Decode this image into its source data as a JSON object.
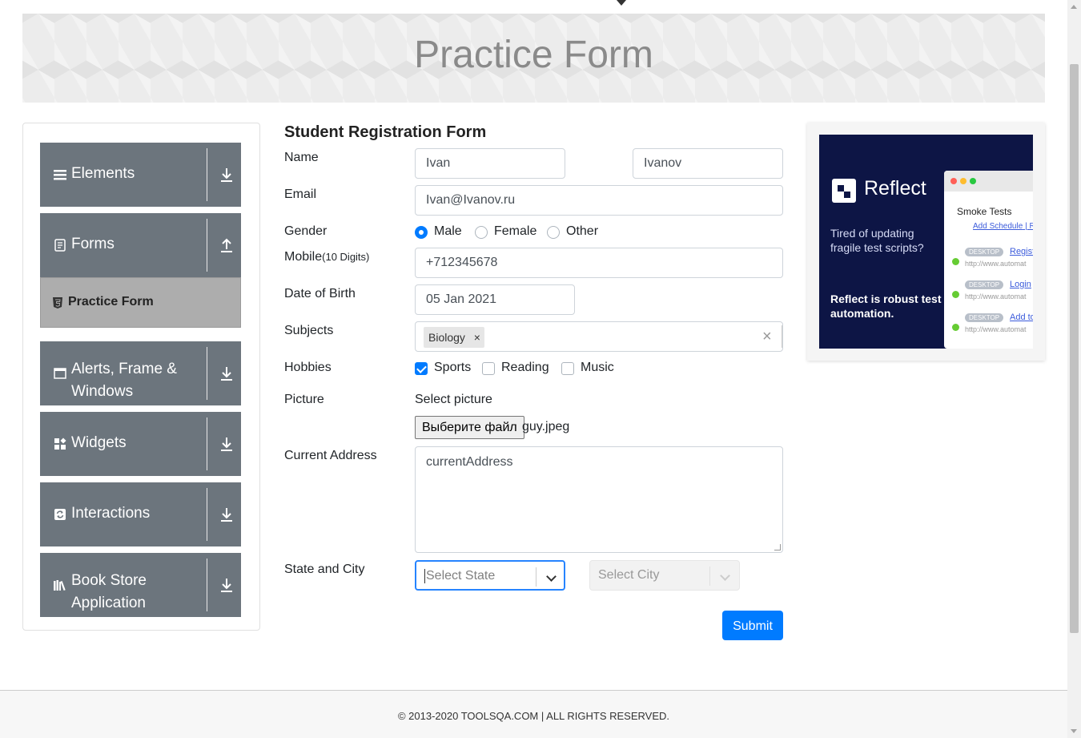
{
  "banner": {
    "title": "Practice Form"
  },
  "sidebar": {
    "groups": [
      {
        "label": "Elements",
        "icon": "hamburger-icon",
        "expanded": false
      },
      {
        "label": "Forms",
        "icon": "document-icon",
        "expanded": true
      },
      {
        "label": "Alerts, Frame & Windows",
        "icon": "window-icon",
        "expanded": false
      },
      {
        "label": "Widgets",
        "icon": "widgets-icon",
        "expanded": false
      },
      {
        "label": "Interactions",
        "icon": "refresh-icon",
        "expanded": false
      },
      {
        "label": "Book Store Application",
        "icon": "books-icon",
        "expanded": false
      }
    ],
    "active_item": {
      "label": "Practice Form",
      "icon": "html5-icon"
    }
  },
  "form": {
    "title": "Student Registration Form",
    "name_label": "Name",
    "first_name": "Ivan",
    "last_name": "Ivanov",
    "email_label": "Email",
    "email": "Ivan@Ivanov.ru",
    "gender_label": "Gender",
    "gender_options": [
      "Male",
      "Female",
      "Other"
    ],
    "gender_selected": "Male",
    "mobile_label": "Mobile",
    "mobile_hint": "(10 Digits)",
    "mobile": "+712345678",
    "dob_label": "Date of Birth",
    "dob": "05 Jan 2021",
    "subjects_label": "Subjects",
    "subjects": [
      "Biology"
    ],
    "chip_remove": "×",
    "clear_symbol": "×",
    "hobbies_label": "Hobbies",
    "hobbies": [
      {
        "label": "Sports",
        "checked": true
      },
      {
        "label": "Reading",
        "checked": false
      },
      {
        "label": "Music",
        "checked": false
      }
    ],
    "picture_label": "Picture",
    "picture_prompt": "Select picture",
    "file_button": "Выберите файл",
    "file_name": "guy.jpeg",
    "address_label": "Current Address",
    "address": "currentAddress",
    "state_city_label": "State and City",
    "state_placeholder": "Select State",
    "city_placeholder": "Select City",
    "submit_label": "Submit"
  },
  "ad": {
    "brand": "Reflect",
    "tagline": "Tired of updating fragile test scripts?",
    "pitch": "Reflect is robust test automation.",
    "window_title": "Smoke Tests",
    "window_link": "Add Schedule",
    "window_link_sep": "|",
    "window_link_2": "Ru",
    "rows": [
      {
        "tag": "DESKTOP",
        "link": "Registr",
        "url": "http://www.automat"
      },
      {
        "tag": "DESKTOP",
        "link": "Login",
        "url": "http://www.automat"
      },
      {
        "tag": "DESKTOP",
        "link": "Add to",
        "url": "http://www.automat"
      }
    ]
  },
  "footer": {
    "text": "© 2013-2020 TOOLSQA.COM | ALL RIGHTS RESERVED."
  },
  "colors": {
    "primary": "#007bff",
    "sidebar": "#6c757d",
    "active_item": "#adadad",
    "ad_bg": "#0d1545"
  }
}
